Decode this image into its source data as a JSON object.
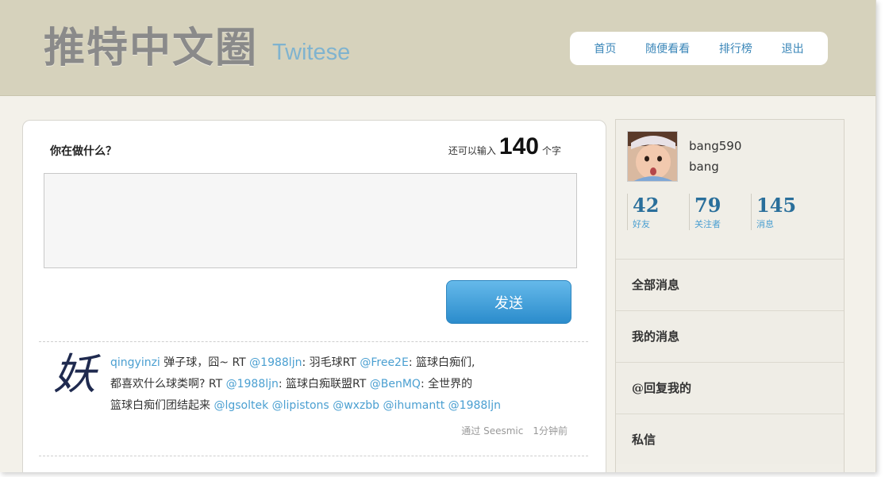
{
  "header": {
    "logo_cn": "推特中文圈",
    "logo_en": "Twitese",
    "nav": [
      "首页",
      "随便看看",
      "排行榜",
      "退出"
    ]
  },
  "composer": {
    "prompt": "你在做什么？",
    "remaining_prefix": "还可以输入",
    "remaining_count": "140",
    "remaining_suffix": "个字",
    "input_value": "",
    "send_label": "发送"
  },
  "tweet": {
    "avatar_char": "妖",
    "user": "qingyinzi",
    "text_1": " 弹子球，囧~ RT ",
    "mention_1": "@1988ljn",
    "text_2": ": 羽毛球RT ",
    "mention_2": "@Free2E",
    "text_3": ": 篮球白痴们,",
    "text_4": "都喜欢什么球类啊? RT ",
    "mention_3": "@1988ljn",
    "text_5": ": 篮球白痴联盟RT ",
    "mention_4": "@BenMQ",
    "text_6": ": 全世界的",
    "text_7": "篮球白痴们团结起来 ",
    "mention_5": "@lgsoltek",
    "mention_6": "@lipistons",
    "mention_7": "@wxzbb",
    "mention_8": "@ihumantt",
    "mention_9": "@1988ljn",
    "meta": "通过 Seesmic　1分钟前"
  },
  "profile": {
    "screen_name": "bang590",
    "name": "bang",
    "stats": [
      {
        "value": "42",
        "label": "好友"
      },
      {
        "value": "79",
        "label": "关注者"
      },
      {
        "value": "145",
        "label": "消息"
      }
    ]
  },
  "menu": [
    "全部消息",
    "我的消息",
    "@回复我的",
    "私信"
  ],
  "colors": {
    "header_bg": "#d6d2bc",
    "link": "#3a86b8",
    "mention": "#4a9fd1",
    "button": "#2b8ccc",
    "stat_number": "#2a6f9b"
  }
}
